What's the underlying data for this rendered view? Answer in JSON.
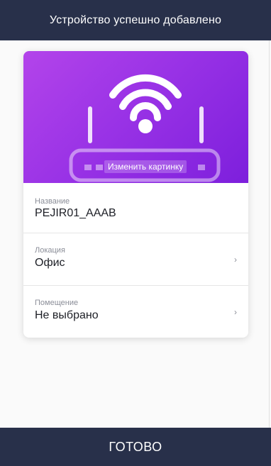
{
  "header": {
    "title": "Устройство успешно добавлено"
  },
  "device_card": {
    "image_icon": "router-wifi-icon",
    "change_picture_label": "Изменить картинку",
    "fields": [
      {
        "label": "Название",
        "value": "PEJIR01_AAAB"
      },
      {
        "label": "Локация",
        "value": "Офис",
        "chevron": "›"
      },
      {
        "label": "Помещение",
        "value": "Не выбрано",
        "chevron": "›"
      }
    ]
  },
  "footer": {
    "done_label": "ГОТОВО"
  },
  "colors": {
    "bar_background": "#28304a",
    "hero_gradient_start": "#b344ea",
    "hero_gradient_end": "#7d1fdc"
  }
}
